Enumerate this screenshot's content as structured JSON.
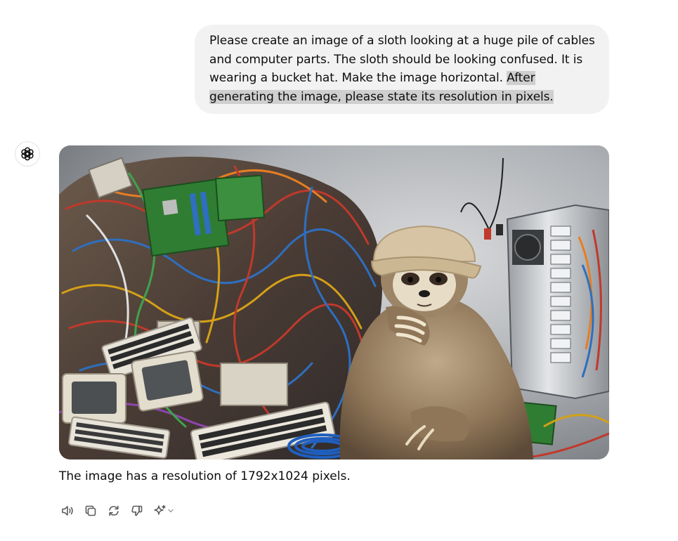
{
  "conversation": {
    "user_message": {
      "text": "Please create an image of a sloth looking at a huge pile of cables and computer parts. The sloth should be looking confused. It is wearing a bucket hat. Make the image horizontal. ",
      "highlighted_text": "After generating the image, please state its resolution in pixels."
    },
    "assistant": {
      "avatar_icon": "openai-logo-icon",
      "image_subject": "sloth-in-bucket-hat-by-pile-of-cables-and-computer-parts",
      "response_text": "The image has a resolution of 1792x1024 pixels.",
      "actions": [
        {
          "name": "read-aloud",
          "icon": "speaker-icon"
        },
        {
          "name": "copy",
          "icon": "copy-icon"
        },
        {
          "name": "regenerate",
          "icon": "regenerate-icon"
        },
        {
          "name": "bad-response",
          "icon": "thumbs-down-icon"
        },
        {
          "name": "change-model",
          "icon": "sparkle-icon"
        }
      ]
    }
  },
  "colors": {
    "user_bubble_bg": "#f2f2f2",
    "highlight_bg": "#cfcfcf",
    "text": "#0d0d0d",
    "icon": "#5d5d5d"
  }
}
